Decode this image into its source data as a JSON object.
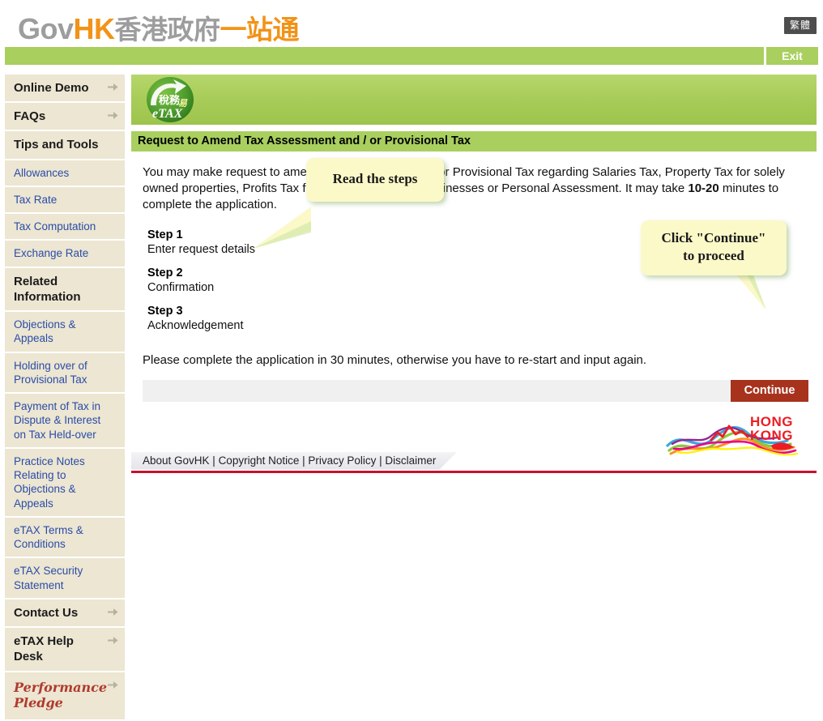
{
  "header": {
    "logo_gov": "Gov",
    "logo_hk": "HK",
    "logo_cn_gray": "香港政府",
    "logo_cn_orange": "一站通",
    "lang_toggle": "繁體"
  },
  "navbar": {
    "exit_label": "Exit"
  },
  "sidebar": {
    "items": [
      {
        "label": "Online Demo",
        "type": "header",
        "arrow": true
      },
      {
        "label": "FAQs",
        "type": "header",
        "arrow": true
      },
      {
        "label": "Tips and Tools",
        "type": "header",
        "arrow": false
      },
      {
        "label": "Allowances",
        "type": "link",
        "arrow": false
      },
      {
        "label": "Tax Rate",
        "type": "link",
        "arrow": false
      },
      {
        "label": "Tax Computation",
        "type": "link",
        "arrow": false
      },
      {
        "label": "Exchange Rate",
        "type": "link",
        "arrow": false
      },
      {
        "label": "Related Information",
        "type": "header",
        "arrow": false
      },
      {
        "label": "Objections & Appeals",
        "type": "link",
        "arrow": false
      },
      {
        "label": "Holding over of Provisional Tax",
        "type": "link",
        "arrow": false
      },
      {
        "label": "Payment of Tax in Dispute & Interest on Tax Held-over",
        "type": "link",
        "arrow": false
      },
      {
        "label": "Practice Notes Relating to Objections & Appeals",
        "type": "link",
        "arrow": false
      },
      {
        "label": "eTAX Terms & Conditions",
        "type": "link",
        "arrow": false
      },
      {
        "label": "eTAX Security Statement",
        "type": "link",
        "arrow": false
      },
      {
        "label": "Contact Us",
        "type": "header",
        "arrow": true
      },
      {
        "label": "eTAX Help Desk",
        "type": "header",
        "arrow": true
      },
      {
        "label": "Performance Pledge",
        "type": "pledge",
        "arrow": true
      }
    ]
  },
  "banner": {
    "etax_cn": "稅務易",
    "etax_en": "eTAX"
  },
  "main": {
    "page_title": "Request to Amend Tax Assessment and / or Provisional Tax",
    "intro_part1": "You may make request to amend Tax Assessment and/or Provisional Tax regarding Salaries Tax, Property Tax for solely owned properties, Profits Tax for sole proprietorship businesses or Personal Assessment. It may take ",
    "intro_bold": "10-20",
    "intro_part2": " minutes to complete the application.",
    "steps": [
      {
        "title": "Step 1",
        "desc": "Enter request details"
      },
      {
        "title": "Step 2",
        "desc": "Confirmation"
      },
      {
        "title": "Step 3",
        "desc": "Acknowledgement"
      }
    ],
    "notice": "Please complete the application in 30 minutes, otherwise you have to re-start and input again.",
    "continue_label": "Continue"
  },
  "callouts": {
    "steps": "Read the steps",
    "continue_line1": "Click \"Continue\"",
    "continue_line2": "to proceed"
  },
  "footer": {
    "links": [
      "About GovHK",
      "Copyright Notice",
      "Privacy Policy",
      "Disclaimer"
    ],
    "separator": "|",
    "brand_line1": "HONG",
    "brand_line2": "KONG"
  },
  "colors": {
    "green_bar": "#a9cf5f",
    "orange_logo": "#f29318",
    "gray_logo": "#9d9d9d",
    "sidebar_bg": "#ece6d2",
    "link_blue": "#2b4ca8",
    "continue_red": "#a8331d",
    "callout_yellow": "#fbf9c8",
    "footer_red": "#c8102e"
  }
}
